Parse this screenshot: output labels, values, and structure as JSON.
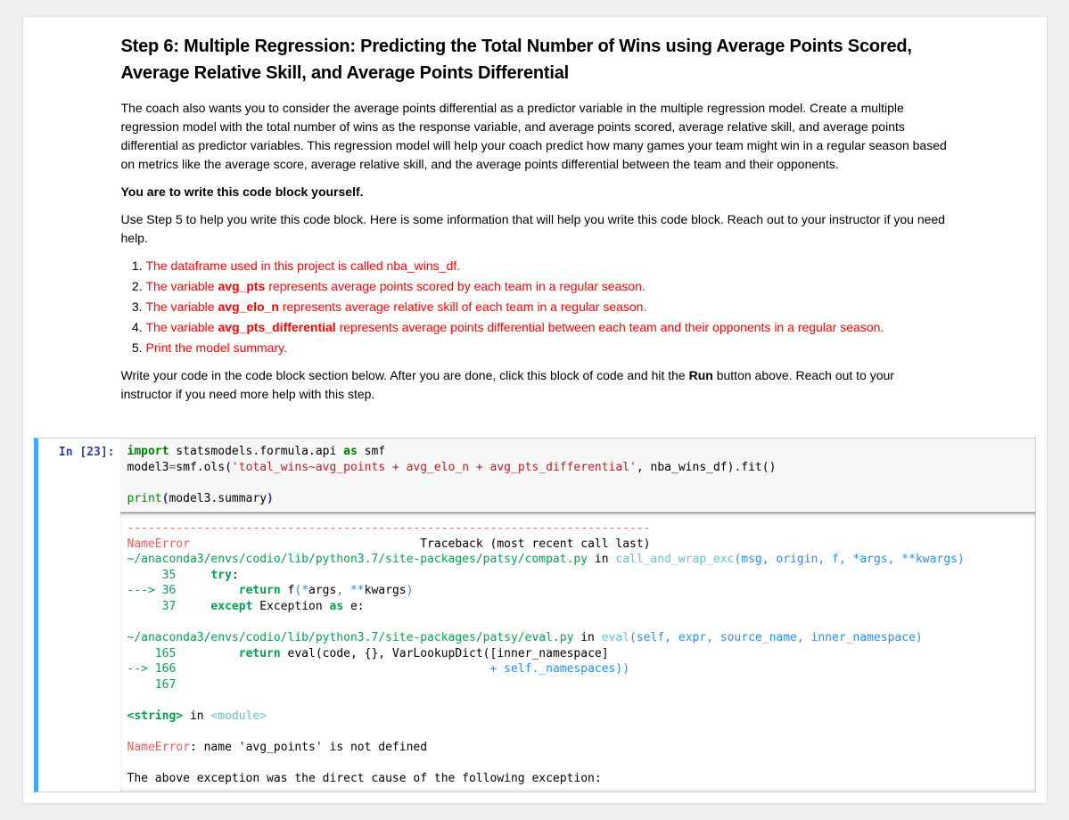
{
  "heading": "Step 6: Multiple Regression: Predicting the Total Number of Wins using Average Points Scored, Average Relative Skill, and Average Points Differential",
  "para1": "The coach also wants you to consider the average points differential as a predictor variable in the multiple regression model. Create a multiple regression model with the total number of wins as the response variable, and average points scored, average relative skill, and average points differential as predictor variables. This regression model will help your coach predict how many games your team might win in a regular season based on metrics like the average score, average relative skill, and the average points differential between the team and their opponents.",
  "para2_bold": "You are to write this code block yourself.",
  "para3": "Use Step 5 to help you write this code block. Here is some information that will help you write this code block. Reach out to your instructor if you need help.",
  "list": {
    "i1": "The dataframe used in this project is called nba_wins_df.",
    "i2a": "The variable ",
    "i2b": "avg_pts",
    "i2c": " represents average points scored by each team in a regular season.",
    "i3a": "The variable ",
    "i3b": "avg_elo_n",
    "i3c": " represents average relative skill of each team in a regular season.",
    "i4a": "The variable ",
    "i4b": "avg_pts_differential",
    "i4c": " represents average points differential between each team and their opponents in a regular season.",
    "i5": "Print the model summary."
  },
  "para4a": "Write your code in the code block section below. After you are done, click this block of code and hit the ",
  "para4b": "Run",
  "para4c": " button above. Reach out to your instructor if you need more help with this step.",
  "prompt": "In [23]:",
  "code": {
    "kw_import": "import",
    "mod": " statsmodels.formula.api ",
    "kw_as": "as",
    "alias": " smf",
    "l2a": "model3",
    "op_eq": "=",
    "l2b": "smf.ols(",
    "str": "'total_wins~avg_points + avg_elo_n + avg_pts_differential'",
    "l2c": ", nba_wins_df).fit()",
    "l3_print": "print",
    "l3_open": "(",
    "l3_arg": "model3.summary",
    "l3_close": ")"
  },
  "err": {
    "dashline": "---------------------------------------------------------------------------",
    "name_error": "NameError",
    "trace_suffix": "                                 Traceback (most recent call last)",
    "f1_path": "~/anaconda3/envs/codio/lib/python3.7/site-packages/patsy/compat.py",
    "in": " in ",
    "f1_func": "call_and_wrap_exc",
    "f1_sig": "(msg, origin, f, *args, **kwargs)",
    "l35_num": "     35 ",
    "l35_kw": "    try",
    "l35_colon": ":",
    "arrow36": "---> 36 ",
    "l36_kw": "        return",
    "l36_rest1": " f",
    "l36_paren_o": "(",
    "l36_star": "*",
    "l36_args": "args",
    "l36_comma": ", ",
    "l36_dstar": "**",
    "l36_kwargs": "kwargs",
    "l36_paren_c": ")",
    "l37_num": "     37 ",
    "l37_kw": "    except",
    "l37_mid": " Exception ",
    "l37_as": "as",
    "l37_e": " e:",
    "f2_path": "~/anaconda3/envs/codio/lib/python3.7/site-packages/patsy/eval.py",
    "f2_func": "eval",
    "f2_sig": "(self, expr, source_name, inner_namespace)",
    "l165_num": "    165 ",
    "l165_kw": "        return",
    "l165_rest": " eval(code, {}, VarLookupDict([inner_namespace]",
    "arrow166": "--> 166 ",
    "l166_spaces": "                                            ",
    "l166_plus": "+",
    "l166_rest": " self._namespaces))",
    "l167_num": "    167 ",
    "string_tag": "<string>",
    "module_tag": "<module>",
    "ne_msg": ": name 'avg_points' is not defined",
    "cause": "The above exception was the direct cause of the following exception:"
  }
}
